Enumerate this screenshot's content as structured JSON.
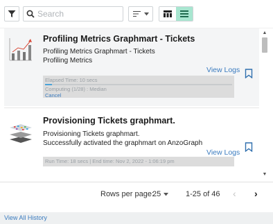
{
  "toolbar": {
    "filter_icon": "filter-funnel-icon",
    "search": {
      "placeholder": "Search",
      "value": ""
    },
    "sort_icon": "sort-lines-icon",
    "view_modes": [
      "table-view-icon",
      "list-view-icon"
    ],
    "active_view": "list",
    "active_color": "#a8e6d0"
  },
  "items": [
    {
      "title": "Profiling Metrics Graphmart - Tickets",
      "subtitle": "Profiling Metrics Graphmart - Tickets",
      "description": "Profiling Metrics",
      "view_logs": "View Logs",
      "elapsed": "Elapsed Time: 10 secs",
      "computing": "Computing (1/28) : Median",
      "progress_fraction": 0.036,
      "cancel": "Cancel",
      "thumb_icon": "bar-line-chart-icon"
    },
    {
      "title": "Provisioning Tickets graphmart.",
      "subtitle": "Provisioning Tickets graphmart.",
      "description": "Successfully activated the graphmart on AnzoGraph",
      "view_logs": "View Logs",
      "runtime": "Run Time: 18 secs | End time: Nov 2, 2022 - 1:06:19 pm",
      "thumb_icon": "stacked-layers-icon"
    }
  ],
  "pagination": {
    "rows_per_page_label": "Rows per page:",
    "rows_per_page": "25",
    "range": "1-25 of 46",
    "prev": "‹",
    "next": "›"
  },
  "footer": {
    "link": "View All History"
  },
  "colors": {
    "link": "#3a7bbf",
    "progress": "#4aa3d8"
  }
}
